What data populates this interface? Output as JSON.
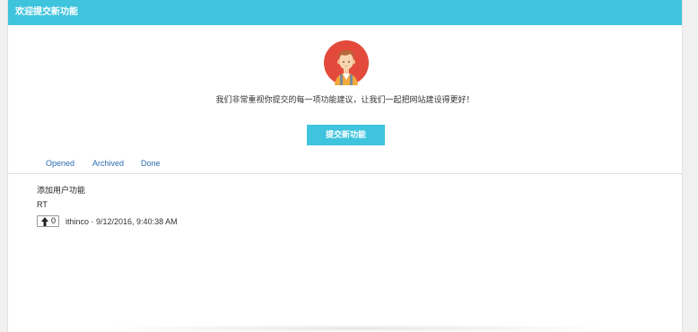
{
  "header": {
    "title": "欢迎提交新功能"
  },
  "intro": {
    "avatar_icon": "user-avatar-icon",
    "message": "我们非常重视你提交的每一项功能建议，让我们一起把网站建设得更好！",
    "submit_label": "提交新功能"
  },
  "tabs": [
    {
      "label": "Opened"
    },
    {
      "label": "Archived"
    },
    {
      "label": "Done"
    }
  ],
  "items": [
    {
      "title": "添加用户功能",
      "description": "RT",
      "votes": "0",
      "meta": "ithinco · 9/12/2016, 9:40:38 AM"
    }
  ],
  "colors": {
    "accent": "#3fc4dd",
    "link": "#2b6cb0",
    "avatar_bg": "#e34a3b"
  }
}
